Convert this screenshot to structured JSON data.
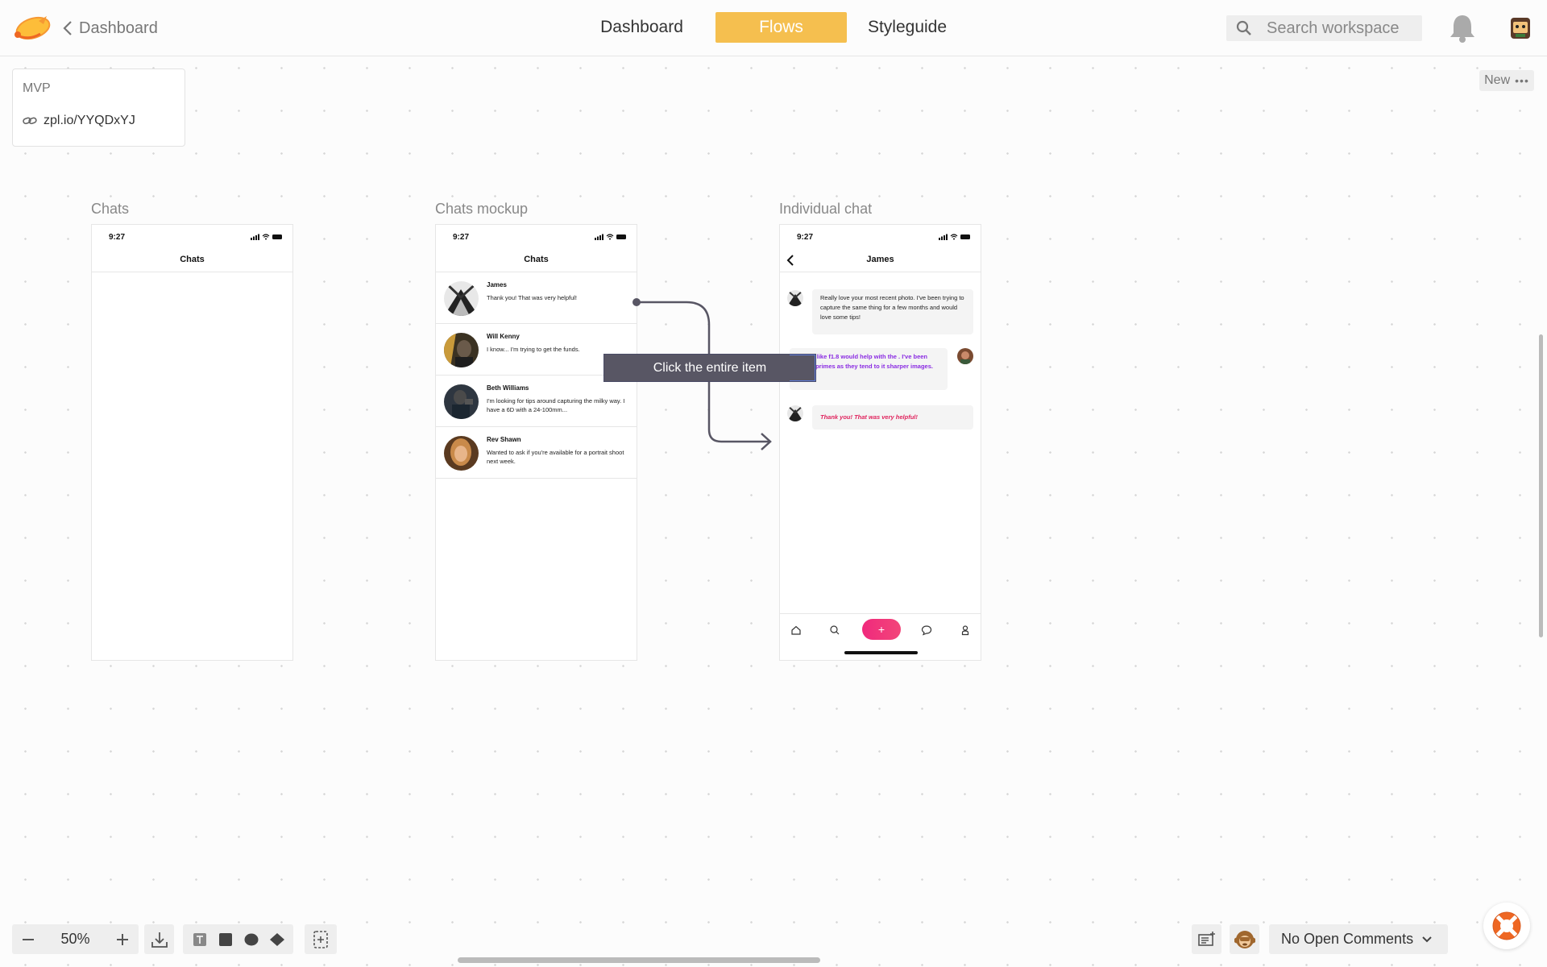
{
  "topbar": {
    "back_label": "Dashboard",
    "tabs": [
      {
        "label": "Dashboard"
      },
      {
        "label": "Flows",
        "active": true
      },
      {
        "label": "Styleguide"
      }
    ],
    "search_placeholder": "Search workspace"
  },
  "project": {
    "title": "MVP",
    "link": "zpl.io/YYQDxYJ",
    "new_label": "New"
  },
  "screens": [
    {
      "label": "Chats",
      "time": "9:27",
      "header": "Chats"
    },
    {
      "label": "Chats mockup",
      "time": "9:27",
      "header": "Chats",
      "rows": [
        {
          "name": "James",
          "message": "Thank you! That was very helpful!"
        },
        {
          "name": "Will Kenny",
          "message": "I know... I'm trying to get the funds."
        },
        {
          "name": "Beth Williams",
          "message": "I'm looking for tips around capturing the milky way. I have a 6D with a 24-100mm..."
        },
        {
          "name": "Rev Shawn",
          "message": "Wanted to ask if you're available for a portrait shoot next week."
        }
      ]
    },
    {
      "label": "Individual chat",
      "time": "9:27",
      "header": "James",
      "messages": [
        {
          "text": "Really love your most recent photo. I've been trying to capture the same thing for a few months and would love some tips!"
        },
        {
          "text": "50mm like f1.8 would help with the . I've been using primes as they tend to it sharper images."
        },
        {
          "text": "Thank you! That was very helpful!"
        }
      ],
      "plus_label": "+"
    }
  ],
  "connector": {
    "tooltip": "Click the entire item"
  },
  "toolbar": {
    "zoom": "50%",
    "comments_label": "No Open Comments"
  },
  "colors": {
    "accent": "#f5bf4f",
    "tooltip_bg": "#585664",
    "purple_text": "#8a2be2",
    "pink_text": "#e0245e",
    "plus_gradient": "#f0297c"
  }
}
